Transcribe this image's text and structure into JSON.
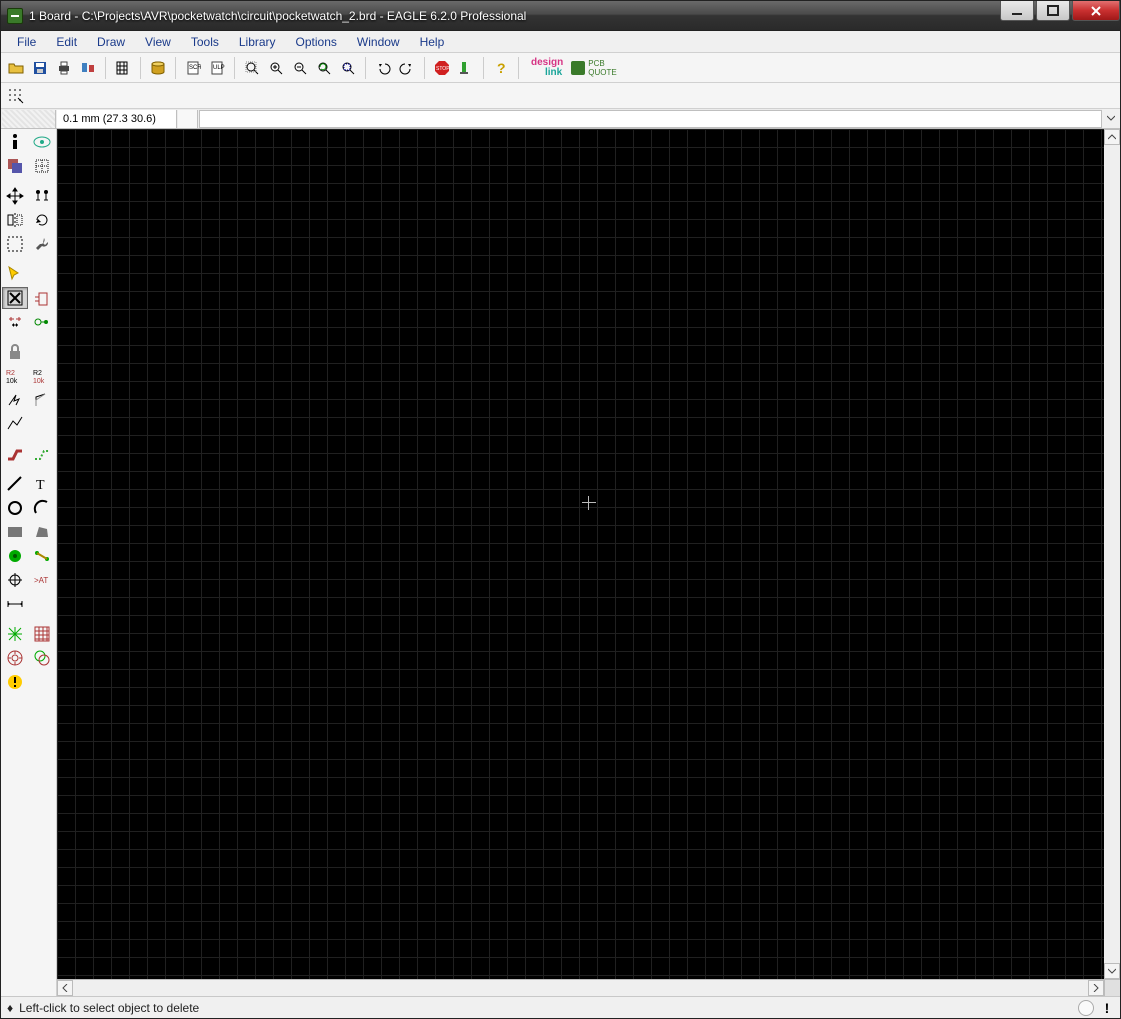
{
  "title": "1 Board - C:\\Projects\\AVR\\pocketwatch\\circuit\\pocketwatch_2.brd - EAGLE 6.2.0 Professional",
  "menu": {
    "file": "File",
    "edit": "Edit",
    "draw": "Draw",
    "view": "View",
    "tools": "Tools",
    "library": "Library",
    "options": "Options",
    "window": "Window",
    "help": "Help"
  },
  "brands": {
    "design": "design",
    "link": "link",
    "pcb1": "PCB",
    "pcb2": "QUOTE"
  },
  "coord": {
    "grid": "0.1 mm (27.3 30.6)",
    "command": ""
  },
  "status": {
    "hint": "Left-click to select object to delete",
    "diamond": "♦",
    "exclaim": "!"
  },
  "icons": {
    "stop": "STOP"
  }
}
